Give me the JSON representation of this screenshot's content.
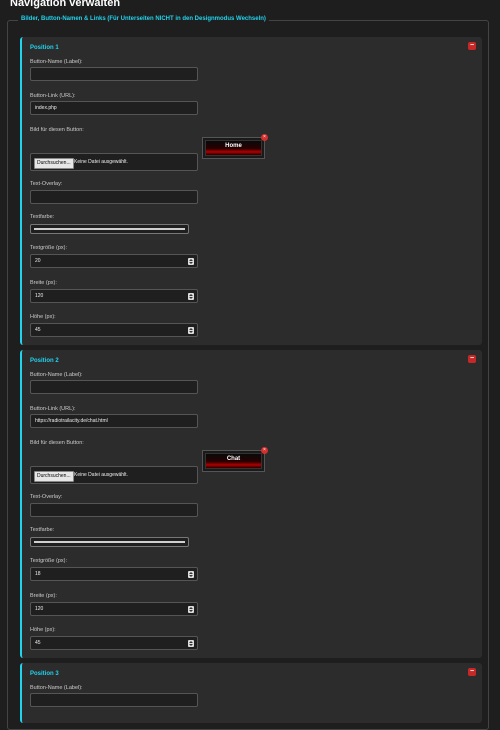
{
  "header": {
    "title": "Navigation verwalten"
  },
  "section": {
    "legend": "Bilder, Button-Namen & Links (Für Unterseiten NICHT in den Designmodus Wechseln)"
  },
  "labels": {
    "button_name": "Button-Name (Label):",
    "button_link": "Button-Link (URL):",
    "image": "Bild für diesen Button:",
    "text_overlay": "Text-Overlay:",
    "text_color": "Textfarbe:",
    "text_size": "Textgröße (px):",
    "width": "Breite (px):",
    "height": "Höhe (px):",
    "file_button": "Durchsuchen...",
    "file_none": "Keine Datei ausgewählt.",
    "remove": "−",
    "remove_image": "×"
  },
  "positions": [
    {
      "title": "Position 1",
      "name": "",
      "link": "index.php",
      "preview_text": "Home",
      "overlay": "",
      "text_color": "#cfcfcf",
      "text_size": "20",
      "width": "120",
      "height": "45"
    },
    {
      "title": "Position 2",
      "name": "",
      "link": "https://radiotrailacity.de/chat.html",
      "preview_text": "Chat",
      "overlay": "",
      "text_color": "#cfcfcf",
      "text_size": "18",
      "width": "120",
      "height": "45"
    },
    {
      "title": "Position 3",
      "name": ""
    }
  ],
  "colors": {
    "accent": "#22d3ee",
    "remove": "#c62828",
    "panel": "#2c2c2c"
  }
}
